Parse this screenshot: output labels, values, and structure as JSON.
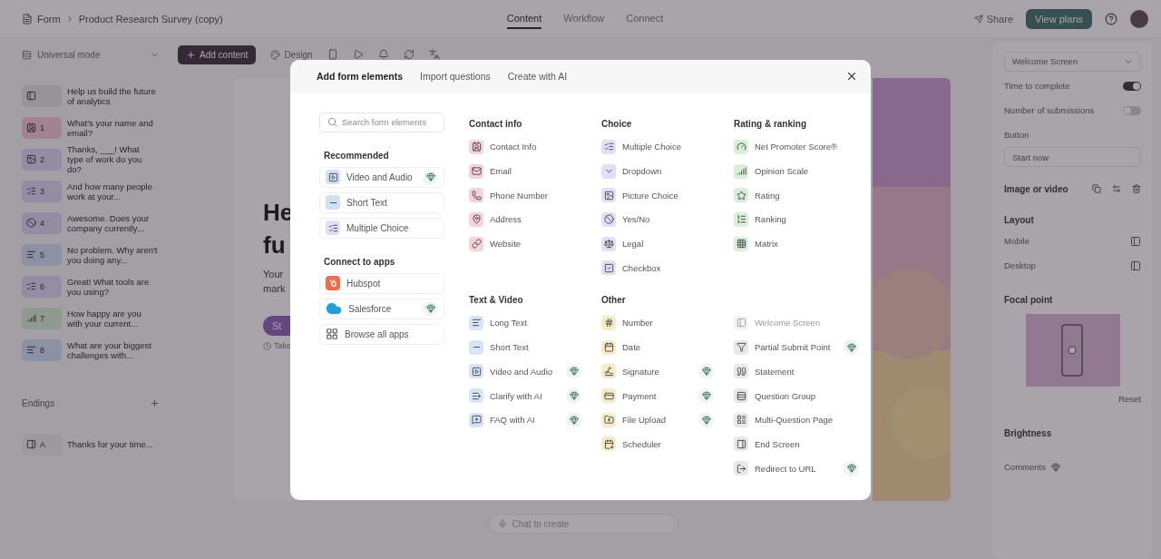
{
  "app_bar": {
    "breadcrumb": [
      "Form",
      "Product Research Survey (copy)"
    ],
    "tabs": [
      {
        "label": "Content",
        "selected": true
      },
      {
        "label": "Workflow",
        "selected": false
      },
      {
        "label": "Connect",
        "selected": false
      }
    ],
    "share": "Share",
    "plans": "View plans"
  },
  "toolbar": {
    "mode": "Universal mode",
    "add": "Add content",
    "design": "Design"
  },
  "sidebar": {
    "questions": [
      {
        "kind": "welcome",
        "text": "Help us build the future of analytics"
      },
      {
        "kind": "contact",
        "number": "1",
        "text": "What's your name and email?"
      },
      {
        "kind": "picture",
        "number": "2",
        "text": "Thanks, ___! What type of work do you do?"
      },
      {
        "kind": "choice",
        "number": "3",
        "text": "And how many people work at your..."
      },
      {
        "kind": "yesno",
        "number": "4",
        "text": "Awesome. Does your company currently..."
      },
      {
        "kind": "text",
        "number": "5",
        "text": "No problem. Why aren't you doing any..."
      },
      {
        "kind": "choice",
        "number": "6",
        "text": "Great! What tools are you using?"
      },
      {
        "kind": "scale",
        "number": "7",
        "text": "How happy are you with your current..."
      },
      {
        "kind": "text",
        "number": "8",
        "text": "What are your biggest challenges with..."
      }
    ],
    "endings_title": "Endings",
    "endings": [
      {
        "kind": "ending",
        "number": "A",
        "text": "Thanks for your time..."
      }
    ]
  },
  "canvas": {
    "heading_lines": [
      "He",
      "fu"
    ],
    "subtitle_lines": [
      "Your",
      "mark"
    ],
    "button": "St",
    "note": "Take",
    "chat_placeholder": "Chat to create"
  },
  "settings": {
    "screen": "Welcome Screen",
    "toggles": [
      {
        "label": "Time to complete",
        "on": true
      },
      {
        "label": "Number of submissions",
        "on": false
      }
    ],
    "button_label": "Button",
    "button_value": "Start now",
    "image_label": "Image or video",
    "layout_label": "Layout",
    "layouts": [
      {
        "label": "Mobile"
      },
      {
        "label": "Desktop"
      }
    ],
    "focal_label": "Focal point",
    "reset": "Reset",
    "brightness": "Brightness",
    "comments": "Comments"
  },
  "dialog": {
    "tabs": [
      {
        "label": "Add form elements",
        "selected": true
      },
      {
        "label": "Import questions",
        "selected": false
      },
      {
        "label": "Create with AI",
        "selected": false
      }
    ],
    "search": {
      "placeholder": "Search form elements"
    },
    "recommended": {
      "title": "Recommended",
      "items": [
        {
          "label": "Video and Audio",
          "premium": true,
          "color": "#cfe0f7"
        },
        {
          "label": "Short Text",
          "premium": false,
          "color": "#cfe0f7"
        },
        {
          "label": "Multiple Choice",
          "premium": false,
          "color": "#e3ddf7"
        }
      ]
    },
    "apps": {
      "title": "Connect to apps",
      "items": [
        {
          "kind": "hubspot",
          "label": "Hubspot",
          "premium": false
        },
        {
          "kind": "salesforce",
          "label": "Salesforce",
          "premium": true
        },
        {
          "kind": "browse",
          "label": "Browse all apps",
          "premium": false
        }
      ]
    },
    "sections": [
      {
        "title": "Contact info",
        "color": "#f6d3da",
        "items": [
          {
            "label": "Contact Info",
            "premium": false,
            "disabled": false
          },
          {
            "label": "Email",
            "premium": false,
            "disabled": false
          },
          {
            "label": "Phone Number",
            "premium": false,
            "disabled": false
          },
          {
            "label": "Address",
            "premium": false,
            "disabled": false
          },
          {
            "label": "Website",
            "premium": false,
            "disabled": false
          }
        ]
      },
      {
        "title": "Choice",
        "color": "#e3ddf7",
        "items": [
          {
            "label": "Multiple Choice",
            "premium": false,
            "disabled": false
          },
          {
            "label": "Dropdown",
            "premium": false,
            "disabled": false
          },
          {
            "label": "Picture Choice",
            "premium": false,
            "disabled": false
          },
          {
            "label": "Yes/No",
            "premium": false,
            "disabled": false
          },
          {
            "label": "Legal",
            "premium": false,
            "disabled": false
          },
          {
            "label": "Checkbox",
            "premium": false,
            "disabled": false
          }
        ]
      },
      {
        "title": "Rating & ranking",
        "color": "#d8efd9",
        "items": [
          {
            "label": "Net Promoter Score®",
            "premium": false,
            "disabled": false
          },
          {
            "label": "Opinion Scale",
            "premium": false,
            "disabled": false
          },
          {
            "label": "Rating",
            "premium": false,
            "disabled": false
          },
          {
            "label": "Ranking",
            "premium": false,
            "disabled": false
          },
          {
            "label": "Matrix",
            "premium": false,
            "disabled": false
          }
        ]
      },
      {
        "title": "Text & Video",
        "color": "#d6e6f8",
        "items": [
          {
            "label": "Long Text",
            "premium": false,
            "disabled": false
          },
          {
            "label": "Short Text",
            "premium": false,
            "disabled": false
          },
          {
            "label": "Video and Audio",
            "premium": true,
            "disabled": false
          },
          {
            "label": "Clarify with AI",
            "premium": true,
            "disabled": false
          },
          {
            "label": "FAQ with AI",
            "premium": true,
            "disabled": false
          }
        ]
      },
      {
        "title": "Other",
        "color": "#f7ecc4",
        "items": [
          {
            "label": "Number",
            "premium": false,
            "disabled": false
          },
          {
            "label": "Date",
            "premium": false,
            "disabled": false
          },
          {
            "label": "Signature",
            "premium": true,
            "disabled": false
          },
          {
            "label": "Payment",
            "premium": true,
            "disabled": false
          },
          {
            "label": "File Upload",
            "premium": true,
            "disabled": false
          },
          {
            "label": "Scheduler",
            "premium": false,
            "disabled": false
          }
        ]
      },
      {
        "color": "#e8e8e8",
        "items": [
          {
            "label": "Welcome Screen",
            "premium": false,
            "disabled": true
          },
          {
            "label": "Partial Submit Point",
            "premium": true,
            "disabled": false
          },
          {
            "label": "Statement",
            "premium": false,
            "disabled": false
          },
          {
            "label": "Question Group",
            "premium": false,
            "disabled": false
          },
          {
            "label": "Multi-Question Page",
            "premium": false,
            "disabled": false
          },
          {
            "label": "End Screen",
            "premium": false,
            "disabled": false
          },
          {
            "label": "Redirect to URL",
            "premium": true,
            "disabled": false
          }
        ]
      }
    ]
  }
}
